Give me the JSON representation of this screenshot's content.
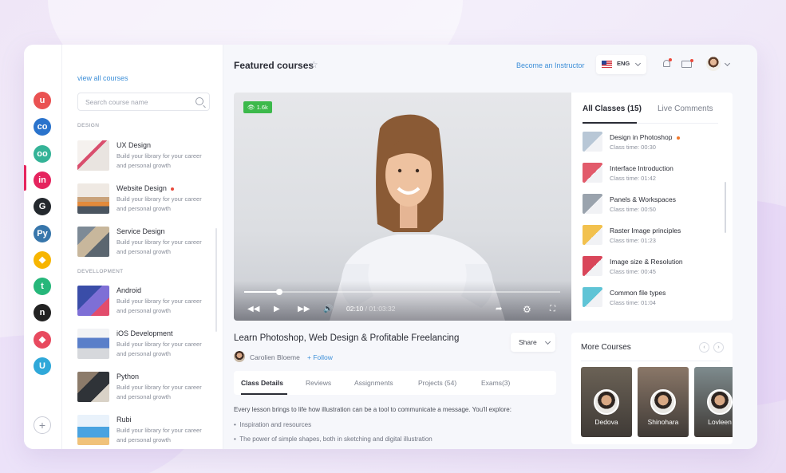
{
  "sidebar": {
    "view_all": "view all courses",
    "search_placeholder": "Search course name",
    "sections": {
      "design": "DESIGN",
      "development": "DEVELLOPMENT"
    },
    "courses": [
      {
        "name": "UX Design",
        "desc": "Build your library for your career and personal growth",
        "dot": false
      },
      {
        "name": "Website Design",
        "desc": "Build your library for your career and personal growth",
        "dot": true
      },
      {
        "name": "Service Design",
        "desc": "Build your library for your career and personal growth",
        "dot": false
      },
      {
        "name": "Android",
        "desc": "Build your library for your career and personal growth",
        "dot": false
      },
      {
        "name": "iOS Development",
        "desc": "Build your library for your career and personal growth",
        "dot": false
      },
      {
        "name": "Python",
        "desc": "Build your library for your career and personal growth",
        "dot": false
      },
      {
        "name": "Rubi",
        "desc": "Build your library for your career and personal growth",
        "dot": false
      }
    ]
  },
  "apps": [
    {
      "icon": "udemy-icon",
      "glyph": "u",
      "color": "#ea5252"
    },
    {
      "icon": "coursera-icon",
      "glyph": "co",
      "color": "#2a73cc"
    },
    {
      "icon": "tripadvisor-icon",
      "glyph": "oo",
      "color": "#34b397"
    },
    {
      "icon": "invision-icon",
      "glyph": "in",
      "color": "#e5245e"
    },
    {
      "icon": "github-icon",
      "glyph": "G",
      "color": "#24292e"
    },
    {
      "icon": "python-icon",
      "glyph": "Py",
      "color": "#3776ab"
    },
    {
      "icon": "sketch-icon",
      "glyph": "◆",
      "color": "#f7b500"
    },
    {
      "icon": "treehouse-icon",
      "glyph": "t",
      "color": "#26b77a"
    },
    {
      "icon": "nodejs-icon",
      "glyph": "n",
      "color": "#222222"
    },
    {
      "icon": "craft-icon",
      "glyph": "◆",
      "color": "#e84a5f"
    },
    {
      "icon": "vuejs-icon",
      "glyph": "U",
      "color": "#2fa8d9"
    }
  ],
  "header": {
    "title": "Featured courses",
    "become_instructor": "Become an Instructor",
    "language": "ENG"
  },
  "video": {
    "views": "1.6k",
    "current_time": "02:10",
    "total_time": "/ 01:03:32",
    "progress": 0.11
  },
  "classes": {
    "tab_all": "All Classes (15)",
    "tab_live": "Live Comments",
    "items": [
      {
        "title": "Design in Photoshop",
        "time": "Class time: 00:30",
        "dot": true,
        "color": "#b8c7d6"
      },
      {
        "title": "Interface Introduction",
        "time": "Class time: 01:42",
        "dot": false,
        "color": "#e25b6b"
      },
      {
        "title": "Panels & Workspaces",
        "time": "Class time: 00:50",
        "dot": false,
        "color": "#9aa3ad"
      },
      {
        "title": "Raster Image principles",
        "time": "Class time: 01:23",
        "dot": false,
        "color": "#f2c14e"
      },
      {
        "title": "Image size & Resolution",
        "time": "Class time: 00:45",
        "dot": false,
        "color": "#d9465a"
      },
      {
        "title": "Common file types",
        "time": "Class time: 01:04",
        "dot": false,
        "color": "#5fc4d6"
      }
    ]
  },
  "course": {
    "title": "Learn Photoshop, Web Design & Profitable Freelancing",
    "instructor": "Carolien Bloeme",
    "follow": "+ Follow",
    "share": "Share",
    "tabs": [
      "Class Details",
      "Reviews",
      "Assignments",
      "Projects (54)",
      "Exams(3)"
    ],
    "description": "Every lesson brings to life how illustration can be a tool to communicate a message. You'll explore:",
    "bullets": [
      "Inspiration and resources",
      "The power of simple shapes, both in sketching and digital illustration"
    ]
  },
  "more_courses": {
    "title": "More Courses",
    "cards": [
      {
        "name": "Dedova",
        "bg": "#6b6256"
      },
      {
        "name": "Shinohara",
        "bg": "#8a7768"
      },
      {
        "name": "Lovleen",
        "bg": "#7e8b8e"
      }
    ]
  }
}
